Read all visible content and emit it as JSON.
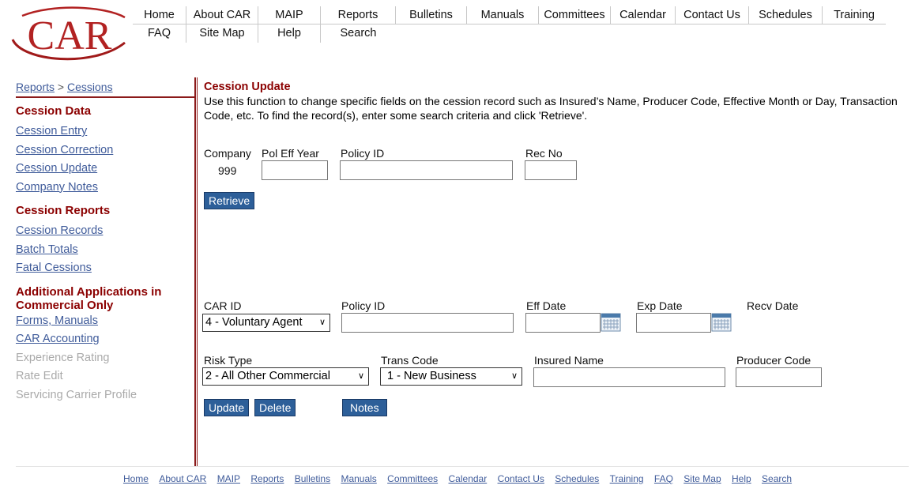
{
  "logo": {
    "text": "CAR"
  },
  "nav": {
    "row1": [
      "Home",
      "About CAR",
      "MAIP",
      "Reports",
      "Bulletins",
      "Manuals",
      "Committees",
      "Calendar",
      "Contact Us",
      "Schedules",
      "Training"
    ],
    "row2": [
      "FAQ",
      "Site Map",
      "Help",
      "Search"
    ]
  },
  "breadcrumb": {
    "parent": "Reports",
    "sep": ">",
    "current": "Cessions"
  },
  "sidebar": {
    "cession_data": {
      "heading": "Cession Data",
      "links": [
        "Cession Entry",
        "Cession Correction",
        "Cession Update",
        "Company Notes"
      ]
    },
    "cession_reports": {
      "heading": "Cession Reports",
      "links": [
        "Cession Records",
        "Batch Totals",
        "Fatal Cessions"
      ]
    },
    "additional": {
      "heading": "Additional Applications in Commercial Only",
      "links": [
        "Forms, Manuals",
        "CAR Accounting"
      ],
      "disabled": [
        "Experience Rating",
        "Rate Edit",
        "Servicing Carrier Profile"
      ]
    }
  },
  "main": {
    "title": "Cession Update",
    "description": "Use this function to change specific fields on the cession record such as Insured’s Name, Producer Code, Effective Month or Day, Transaction Code, etc.  To find the record(s), enter some search criteria and click 'Retrieve'.",
    "search": {
      "company_label": "Company",
      "company_value": "999",
      "pol_eff_year_label": "Pol Eff Year",
      "policy_id_label": "Policy ID",
      "rec_no_label": "Rec No",
      "retrieve_label": "Retrieve"
    },
    "edit": {
      "car_id_label": "CAR ID",
      "car_id_value": "4 - Voluntary Agent",
      "policy_id_label": "Policy ID",
      "eff_date_label": "Eff Date",
      "exp_date_label": "Exp Date",
      "recv_date_label": "Recv Date",
      "risk_type_label": "Risk Type",
      "risk_type_value": "2 - All Other Commercial",
      "trans_code_label": "Trans Code",
      "trans_code_value": "1 - New Business",
      "insured_name_label": "Insured Name",
      "producer_code_label": "Producer Code",
      "update_label": "Update",
      "delete_label": "Delete",
      "notes_label": "Notes"
    }
  },
  "footer": {
    "links": [
      "Home",
      "About CAR",
      "MAIP",
      "Reports",
      "Bulletins",
      "Manuals",
      "Committees",
      "Calendar",
      "Contact Us",
      "Schedules",
      "Training",
      "FAQ",
      "Site Map",
      "Help",
      "Search"
    ]
  },
  "colors": {
    "brand_red": "#8b0000",
    "link_blue": "#3f5b9a",
    "button_blue": "#2d5f99"
  }
}
